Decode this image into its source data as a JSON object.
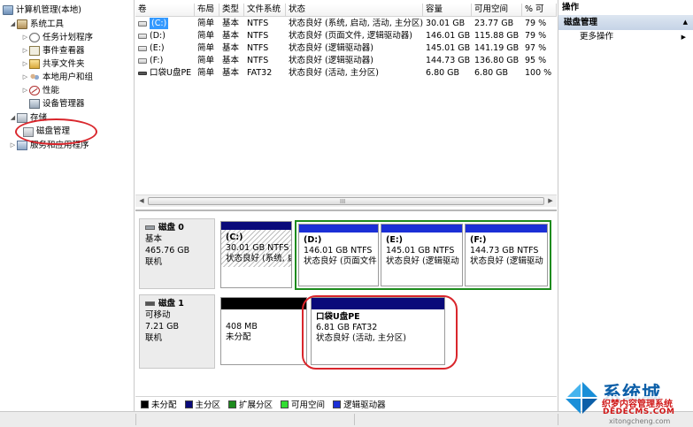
{
  "tree": {
    "root": "计算机管理(本地)",
    "system_tools": "系统工具",
    "task_scheduler": "任务计划程序",
    "event_viewer": "事件查看器",
    "shared_folders": "共享文件夹",
    "local_users": "本地用户和组",
    "performance": "性能",
    "device_manager": "设备管理器",
    "storage": "存储",
    "disk_management": "磁盘管理",
    "services_apps": "服务和应用程序"
  },
  "volume_table": {
    "headers": [
      "卷",
      "布局",
      "类型",
      "文件系统",
      "状态",
      "容量",
      "可用空间",
      "% 可"
    ],
    "rows": [
      {
        "volume": "(C:)",
        "layout": "简单",
        "type": "基本",
        "fs": "NTFS",
        "status": "状态良好 (系统, 启动, 活动, 主分区)",
        "capacity": "30.01 GB",
        "free": "23.77 GB",
        "pct": "79 %"
      },
      {
        "volume": "(D:)",
        "layout": "简单",
        "type": "基本",
        "fs": "NTFS",
        "status": "状态良好 (页面文件, 逻辑驱动器)",
        "capacity": "146.01 GB",
        "free": "115.88 GB",
        "pct": "79 %"
      },
      {
        "volume": "(E:)",
        "layout": "简单",
        "type": "基本",
        "fs": "NTFS",
        "status": "状态良好 (逻辑驱动器)",
        "capacity": "145.01 GB",
        "free": "141.19 GB",
        "pct": "97 %"
      },
      {
        "volume": "(F:)",
        "layout": "简单",
        "type": "基本",
        "fs": "NTFS",
        "status": "状态良好 (逻辑驱动器)",
        "capacity": "144.73 GB",
        "free": "136.80 GB",
        "pct": "95 %"
      },
      {
        "volume": "口袋U盘PE",
        "layout": "简单",
        "type": "基本",
        "fs": "FAT32",
        "status": "状态良好 (活动, 主分区)",
        "capacity": "6.80 GB",
        "free": "6.80 GB",
        "pct": "100 %"
      }
    ],
    "scroll_grip": "III"
  },
  "disks": [
    {
      "name": "磁盘 0",
      "type": "基本",
      "size": "465.76 GB",
      "status": "联机",
      "partitions": [
        {
          "label": "(C:)",
          "size_fs": "30.01 GB NTFS",
          "status": "状态良好 (系统, 启动"
        },
        {
          "label": "(D:)",
          "size_fs": "146.01 GB NTFS",
          "status": "状态良好 (页面文件"
        },
        {
          "label": "(E:)",
          "size_fs": "145.01 GB NTFS",
          "status": "状态良好 (逻辑驱动"
        },
        {
          "label": "(F:)",
          "size_fs": "144.73 GB NTFS",
          "status": "状态良好 (逻辑驱动"
        }
      ]
    },
    {
      "name": "磁盘 1",
      "type": "可移动",
      "size": "7.21 GB",
      "status": "联机",
      "partitions": [
        {
          "label": "",
          "size_fs": "408 MB",
          "status": "未分配"
        },
        {
          "label": "口袋U盘PE",
          "size_fs": "6.81 GB FAT32",
          "status": "状态良好 (活动, 主分区)"
        }
      ]
    }
  ],
  "legend": [
    {
      "label": "未分配",
      "color": "#000000"
    },
    {
      "label": "主分区",
      "color": "#0a0a7a"
    },
    {
      "label": "扩展分区",
      "color": "#1d8b1d"
    },
    {
      "label": "可用空间",
      "color": "#33dd33"
    },
    {
      "label": "逻辑驱动器",
      "color": "#1b2fd6"
    }
  ],
  "actions": {
    "title": "操作",
    "section": "磁盘管理",
    "more": "更多操作"
  },
  "watermark": {
    "brand": "系统城",
    "sub": "织梦内容管理系统",
    "dede": "DEDECMS.COM",
    "url": "xitongcheng.com"
  },
  "colors": {
    "annotation_red": "#d9262c",
    "selection_blue": "#3399ff",
    "extended_green": "#1d8b1d"
  }
}
